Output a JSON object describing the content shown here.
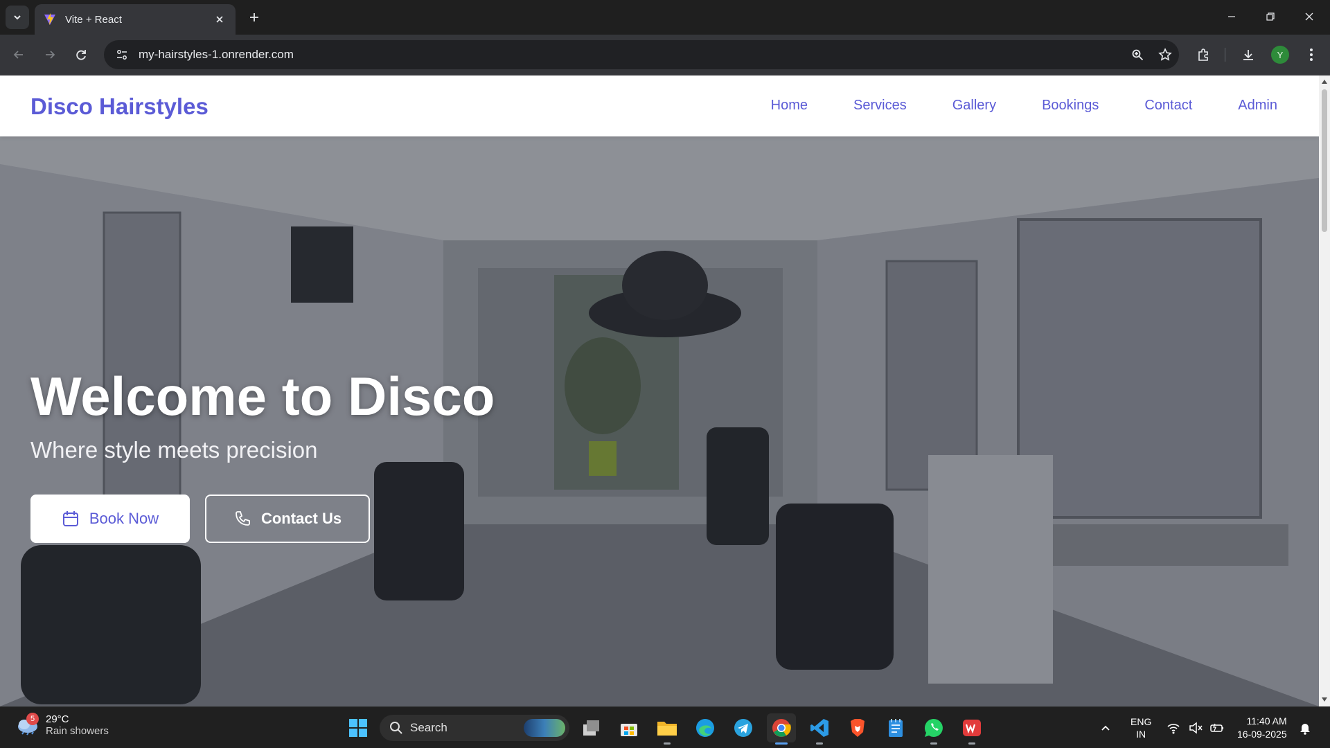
{
  "browser": {
    "tab_title": "Vite + React",
    "url": "my-hairstyles-1.onrender.com",
    "profile_initial": "Y"
  },
  "site": {
    "brand": "Disco Hairstyles",
    "nav": [
      "Home",
      "Services",
      "Gallery",
      "Bookings",
      "Contact",
      "Admin"
    ],
    "hero": {
      "title": "Welcome to Disco",
      "subtitle": "Where style meets precision",
      "book_label": "Book Now",
      "contact_label": "Contact Us"
    }
  },
  "taskbar": {
    "weather": {
      "badge": "5",
      "temp": "29°C",
      "desc": "Rain showers"
    },
    "search_label": "Search",
    "lang_1": "ENG",
    "lang_2": "IN",
    "time": "11:40 AM",
    "date": "16-09-2025"
  },
  "colors": {
    "brand": "#5b5bd6",
    "chrome_dark": "#1f1f1f",
    "toolbar": "#35363a"
  }
}
